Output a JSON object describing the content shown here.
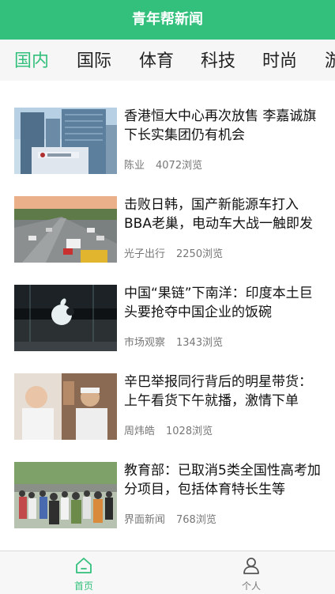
{
  "app": {
    "title": "青年帮新闻"
  },
  "tabs": [
    "国内",
    "国际",
    "体育",
    "科技",
    "时尚",
    "游"
  ],
  "news": [
    {
      "title": "香港恒大中心再次放售 李嘉诚旗下长实集团仍有机会",
      "author": "陈业",
      "views": "4072浏览"
    },
    {
      "title": "击败日韩，国产新能源车打入BBA老巢，电动车大战一触即发",
      "author": "光子出行",
      "views": "2250浏览"
    },
    {
      "title": "中国“果链”下南洋：印度本土巨头要抢夺中国企业的饭碗",
      "author": "市场观察",
      "views": "1343浏览"
    },
    {
      "title": "辛巴举报同行背后的明星带货：上午看货下午就播，激情下单",
      "author": "周炜皓",
      "views": "1028浏览"
    },
    {
      "title": "教育部：已取消5类全国性高考加分项目，包括体育特长生等",
      "author": "界面新闻",
      "views": "768浏览"
    }
  ],
  "tabbar": {
    "home": "首页",
    "me": "个人"
  },
  "colors": {
    "brand": "#33c07c",
    "tab_background": "#f6f6f6",
    "text": "#222222",
    "meta_text": "#777777"
  },
  "icons": {
    "home": "home-icon",
    "me": "person-icon"
  }
}
